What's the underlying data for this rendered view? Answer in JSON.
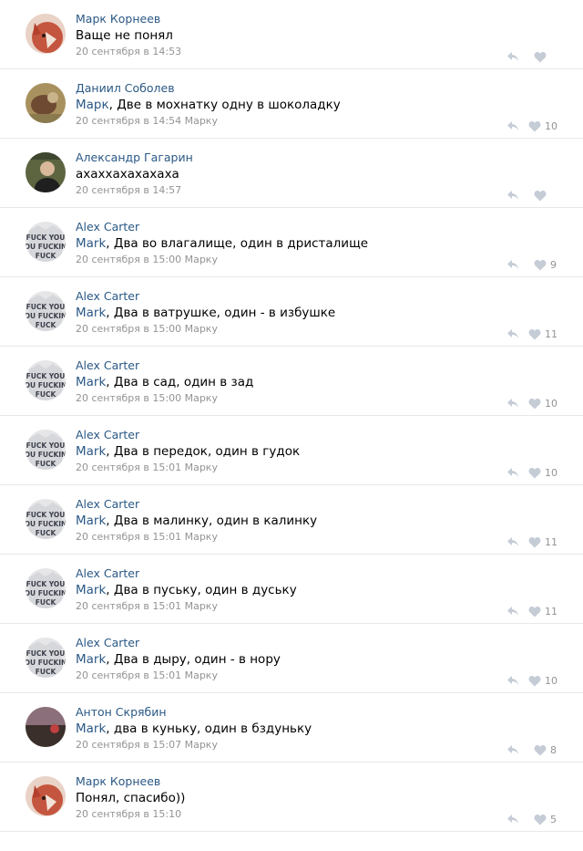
{
  "colors": {
    "link": "#2a5885",
    "meta": "#939393",
    "divider": "#e7e8ec",
    "icon": "#c5ccd6"
  },
  "comments": [
    {
      "author": "Марк Корнеев",
      "reply_to": "",
      "text": "Ваще не понял",
      "time": "20 сентября в 14:53",
      "likes": "",
      "avatar": "fox"
    },
    {
      "author": "Даниил Соболев",
      "reply_to": "Марк",
      "text": "Две в мохнатку одну в шоколадку",
      "time": "20 сентября в 14:54 Марку",
      "likes": "10",
      "avatar": "photo-warm"
    },
    {
      "author": "Александр Гагарин",
      "reply_to": "",
      "text": "ахаххахахахаха",
      "time": "20 сентября в 14:57",
      "likes": "",
      "avatar": "photo-dark"
    },
    {
      "author": "Alex Carter",
      "reply_to": "Mark",
      "text": "Два во влагалище, один в дристалище",
      "time": "20 сентября в 15:00 Марку",
      "likes": "9",
      "avatar": "text-shirt"
    },
    {
      "author": "Alex Carter",
      "reply_to": "Mark",
      "text": "Два в ватрушке, один - в избушке",
      "time": "20 сентября в 15:00 Марку",
      "likes": "11",
      "avatar": "text-shirt"
    },
    {
      "author": "Alex Carter",
      "reply_to": "Mark",
      "text": "Два в сад, один в зад",
      "time": "20 сентября в 15:00 Марку",
      "likes": "10",
      "avatar": "text-shirt"
    },
    {
      "author": "Alex Carter",
      "reply_to": "Mark",
      "text": "Два в передок, один в гудок",
      "time": "20 сентября в 15:01 Марку",
      "likes": "10",
      "avatar": "text-shirt"
    },
    {
      "author": "Alex Carter",
      "reply_to": "Mark",
      "text": "Два в малинку, один в калинку",
      "time": "20 сентября в 15:01 Марку",
      "likes": "11",
      "avatar": "text-shirt"
    },
    {
      "author": "Alex Carter",
      "reply_to": "Mark",
      "text": "Два в пуську, один в дуську",
      "time": "20 сентября в 15:01 Марку",
      "likes": "11",
      "avatar": "text-shirt"
    },
    {
      "author": "Alex Carter",
      "reply_to": "Mark",
      "text": "Два в дыру, один - в нору",
      "time": "20 сентября в 15:01 Марку",
      "likes": "10",
      "avatar": "text-shirt"
    },
    {
      "author": "Антон Скрябин",
      "reply_to": "Mark",
      "text": "два в куньку, один в бздуньку",
      "time": "20 сентября в 15:07 Марку",
      "likes": "8",
      "avatar": "photo-landscape"
    },
    {
      "author": "Марк Корнеев",
      "reply_to": "",
      "text": "Понял, спасибо))",
      "time": "20 сентября в 15:10",
      "likes": "5",
      "avatar": "fox"
    }
  ],
  "avatar_text": {
    "line1": "FUCK YOU",
    "line2": "OU FUCKIN",
    "line3": "FUCK"
  }
}
